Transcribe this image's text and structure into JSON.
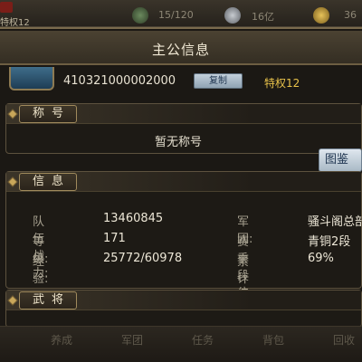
{
  "hud": {
    "vip_label": "特权12",
    "stamina": "15/120",
    "silver": "16亿",
    "gold": "36"
  },
  "panel": {
    "title": "主公信息",
    "player_id": "410321000002000",
    "copy_label": "复制",
    "privilege": "特权12"
  },
  "title_section": {
    "label": "称号",
    "no_title_text": "暂无称号",
    "gallery_label": "图鉴"
  },
  "info_section": {
    "label": "信息",
    "left": [
      {
        "label": "队伍战力:",
        "value": "13460845"
      },
      {
        "label": "等　　级:",
        "value": "171"
      },
      {
        "label": "经　　验:",
        "value": "25772/60978"
      }
    ],
    "right": [
      {
        "label": "军　　团:",
        "value": "骚斗阁总部"
      },
      {
        "label": "赛季段位:",
        "value": "青铜2段"
      },
      {
        "label": "累计胜率:",
        "value": "69%"
      }
    ]
  },
  "generals_section": {
    "label": "武将"
  },
  "bottom_nav": [
    "养成",
    "军团",
    "任务",
    "背包",
    "回收"
  ],
  "colors": {
    "gold_text": "#e9c24a",
    "panel_bg": "#1b1814",
    "frame": "#7a6b4d"
  }
}
